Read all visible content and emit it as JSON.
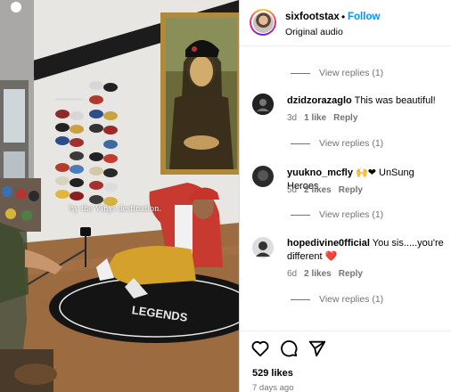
{
  "post": {
    "caption_overlay": "by the Vinyl destination.",
    "mat_text": "LEGENDS"
  },
  "header": {
    "username": "sixfootstax",
    "separator": "•",
    "follow_label": "Follow",
    "audio_label": "Original audio"
  },
  "comments": {
    "view_replies_label": "View replies (1)",
    "items": [
      {
        "username": "dzidzorazaglo",
        "text": "This was beautiful!",
        "time": "3d",
        "likes": "1 like",
        "reply": "Reply"
      },
      {
        "username": "yuukno_mcfly",
        "text": "🙌❤ UnSung Heroes",
        "time": "5d",
        "likes": "2 likes",
        "reply": "Reply"
      },
      {
        "username": "hopedivine0fficial",
        "text": "You sis.....you're different ❤️",
        "time": "6d",
        "likes": "2 likes",
        "reply": "Reply"
      }
    ]
  },
  "footer": {
    "likes": "529 likes",
    "date": "7 days ago"
  },
  "colors": {
    "accent": "#0095f6",
    "muted": "#737373",
    "heart": "#ed4956"
  }
}
